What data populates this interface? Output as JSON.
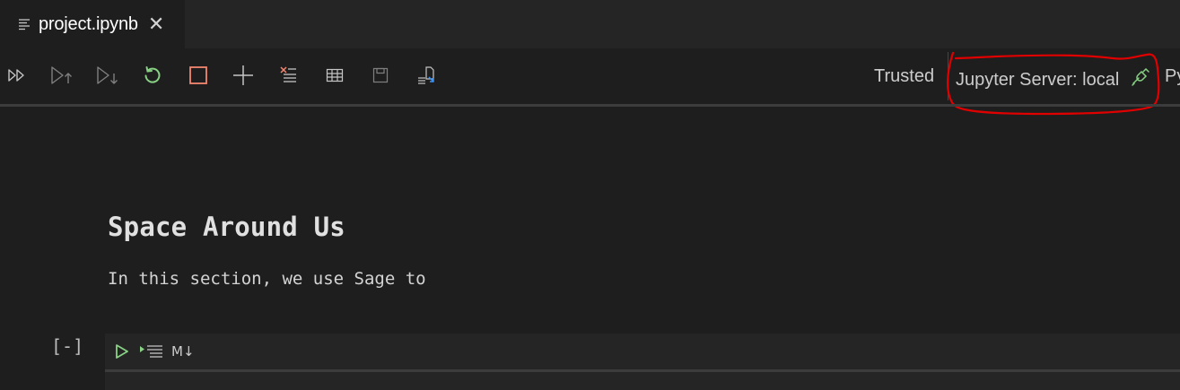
{
  "tab": {
    "title": "project.ipynb",
    "file_icon": "file-lines-icon",
    "close_glyph": "✕"
  },
  "toolbar": {
    "buttons": [
      {
        "name": "run-all-button",
        "icon": "run-all-icon"
      },
      {
        "name": "run-above-button",
        "icon": "run-above-icon"
      },
      {
        "name": "run-below-button",
        "icon": "run-below-icon"
      },
      {
        "name": "restart-kernel-button",
        "icon": "restart-icon"
      },
      {
        "name": "interrupt-kernel-button",
        "icon": "stop-icon"
      },
      {
        "name": "add-cell-button",
        "icon": "plus-icon"
      },
      {
        "name": "clear-outputs-button",
        "icon": "clear-outputs-icon"
      },
      {
        "name": "variable-explorer-button",
        "icon": "table-icon"
      },
      {
        "name": "save-button",
        "icon": "save-icon"
      },
      {
        "name": "export-button",
        "icon": "export-icon"
      }
    ],
    "trusted_label": "Trusted",
    "server_label": "Jupyter Server: local",
    "server_icon": "plug-connected-icon",
    "kernel_label": "Py",
    "colors": {
      "restart": "#89d185",
      "stop": "#f48771",
      "clear": "#f48771",
      "plug": "#89d185",
      "annotation": "#e00000"
    }
  },
  "markdown_cell": {
    "heading": "Space Around Us",
    "paragraph": "In this section, we use Sage to"
  },
  "code_cell": {
    "execution_count": "[-]",
    "markdown_toggle": "M↓",
    "run_color": "#89d185"
  }
}
